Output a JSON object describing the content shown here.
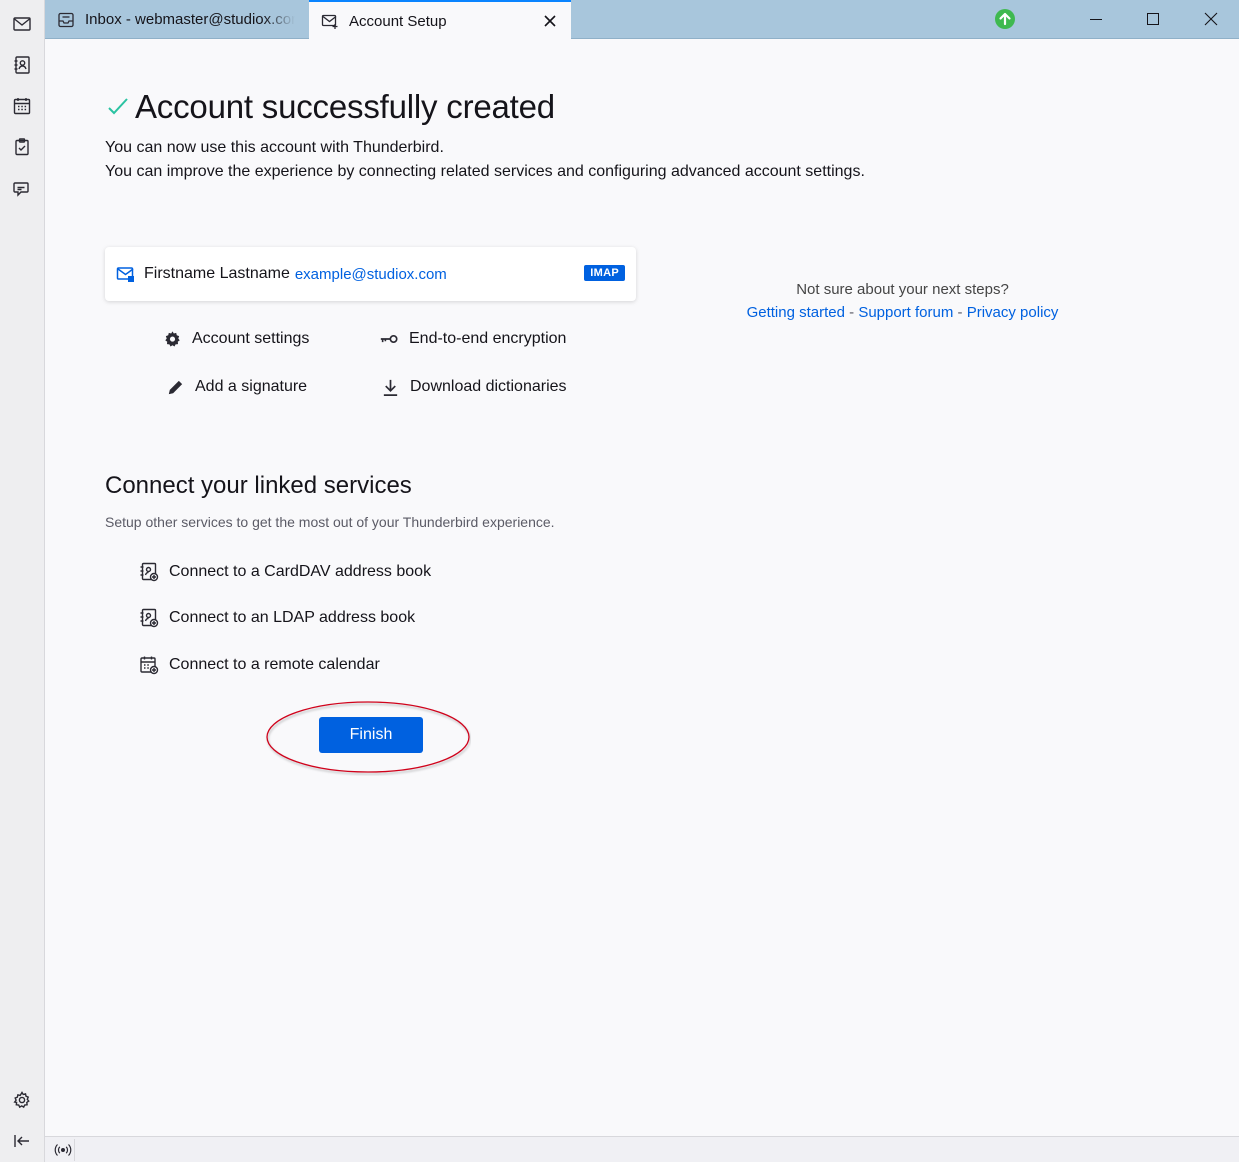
{
  "tabs": [
    {
      "label": "Inbox - webmaster@studiox.com",
      "icon": "inbox-icon"
    },
    {
      "label": "Account Setup",
      "icon": "account-setup-icon"
    }
  ],
  "main": {
    "title": "Account successfully created",
    "line1": "You can now use this account with Thunderbird.",
    "line2": "You can improve the experience by connecting related services and configuring advanced account settings."
  },
  "account": {
    "name": "Firstname Lastname",
    "email": "example@studiox.com",
    "badge": "IMAP"
  },
  "actions": {
    "account_settings": "Account settings",
    "e2e": "End-to-end encryption",
    "signature": "Add a signature",
    "dictionaries": "Download dictionaries"
  },
  "help": {
    "question": "Not sure about your next steps?",
    "getting_started": "Getting started",
    "support_forum": "Support forum",
    "privacy_policy": "Privacy policy",
    "separator": " - "
  },
  "linked": {
    "title": "Connect your linked services",
    "subtitle": "Setup other services to get the most out of your Thunderbird experience.",
    "carddav": "Connect to a CardDAV address book",
    "ldap": "Connect to an LDAP address book",
    "calendar": "Connect to a remote calendar"
  },
  "finish_label": "Finish",
  "colors": {
    "accent": "#0061e0",
    "tabbar": "#a8c6dc",
    "success": "#2ac3a2",
    "highlight": "#d0021b",
    "update": "#3fb950"
  }
}
